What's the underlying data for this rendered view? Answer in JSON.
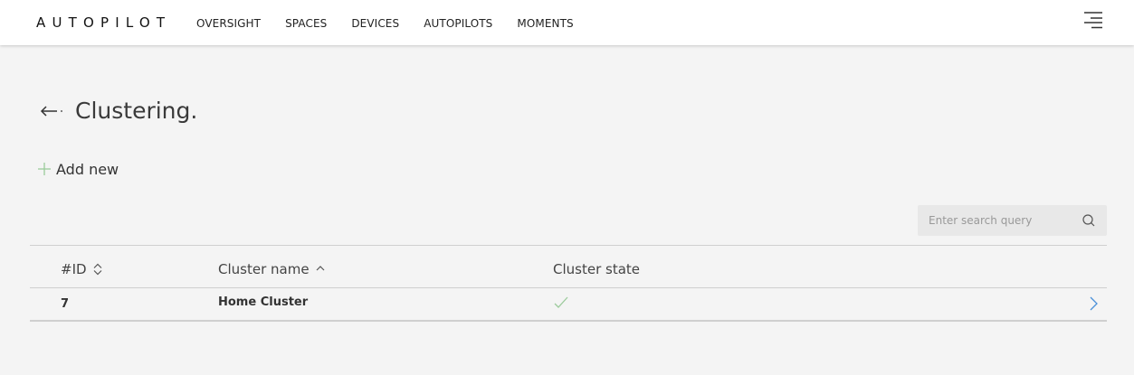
{
  "header": {
    "logo": "AUTOPILOT",
    "nav": [
      "OVERSIGHT",
      "SPACES",
      "DEVICES",
      "AUTOPILOTS",
      "MOMENTS"
    ],
    "menu_icon": "hamburger-menu-icon"
  },
  "page": {
    "title": "Clustering.",
    "back_icon": "back-arrow-icon",
    "add_new_label": "Add new",
    "add_icon": "plus-icon"
  },
  "search": {
    "placeholder": "Enter search query",
    "value": "",
    "icon": "search-icon"
  },
  "table": {
    "columns": [
      {
        "label": "#ID",
        "sort": "unsorted"
      },
      {
        "label": "Cluster name",
        "sort": "ascending"
      },
      {
        "label": "Cluster state",
        "sort": "none"
      }
    ],
    "rows": [
      {
        "id": "7",
        "name": "Home Cluster",
        "state": "check-icon",
        "action": "chevron-right-icon"
      }
    ]
  },
  "colors": {
    "background": "#f4f4f4",
    "header_bg": "#ffffff",
    "accent_green": "#9ccb9c",
    "accent_blue": "#4a90d9",
    "search_bg": "#e8e8e8"
  }
}
